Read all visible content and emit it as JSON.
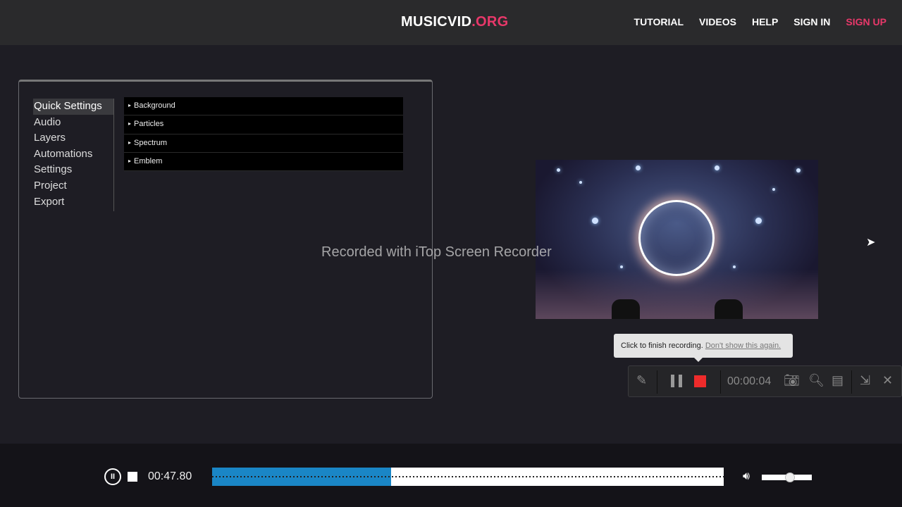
{
  "header": {
    "logo_main": "MUSICVID",
    "logo_suffix": ".ORG",
    "nav": [
      "TUTORIAL",
      "VIDEOS",
      "HELP",
      "SIGN IN",
      "SIGN UP"
    ],
    "accent": "#e8386a"
  },
  "editor": {
    "menu": [
      "Quick Settings",
      "Audio",
      "Layers",
      "Automations",
      "Settings",
      "Project",
      "Export"
    ],
    "active_menu": "Quick Settings",
    "sections": [
      "Background",
      "Particles",
      "Spectrum",
      "Emblem"
    ]
  },
  "watermark": "Recorded with iTop Screen Recorder",
  "recorder": {
    "tooltip_text": "Click to finish recording.",
    "tooltip_link": "Don't show this again.",
    "elapsed": "00:00:04",
    "stop_color": "#ee2b2b"
  },
  "player": {
    "time": "00:47.80",
    "progress": 0.35,
    "volume": 0.56,
    "wave_color": "#1a86c6"
  }
}
